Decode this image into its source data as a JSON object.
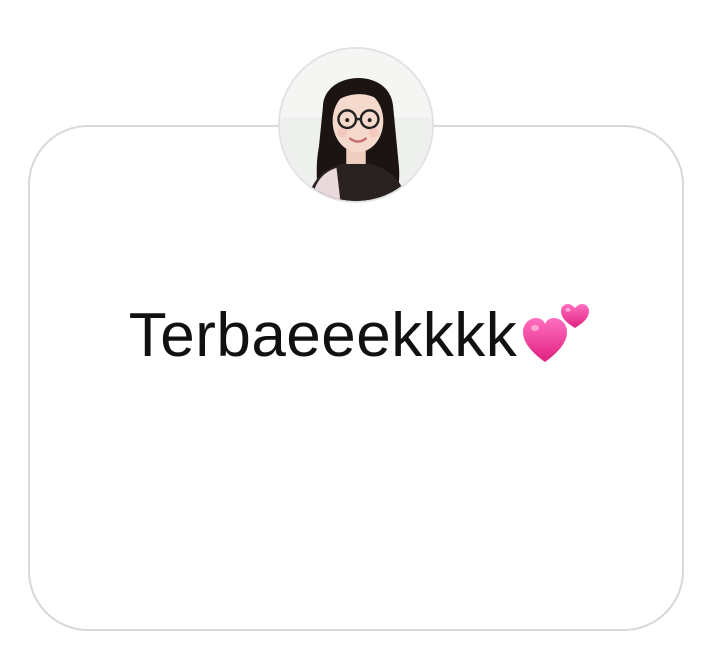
{
  "message": {
    "text": "Terbaeeekkkk",
    "emoji_icon": "two-hearts-icon"
  },
  "profile": {
    "avatar_icon": "avatar-photo"
  },
  "colors": {
    "heart": "#ee2f92",
    "card_border": "#d8d8d8",
    "text": "#111111"
  }
}
